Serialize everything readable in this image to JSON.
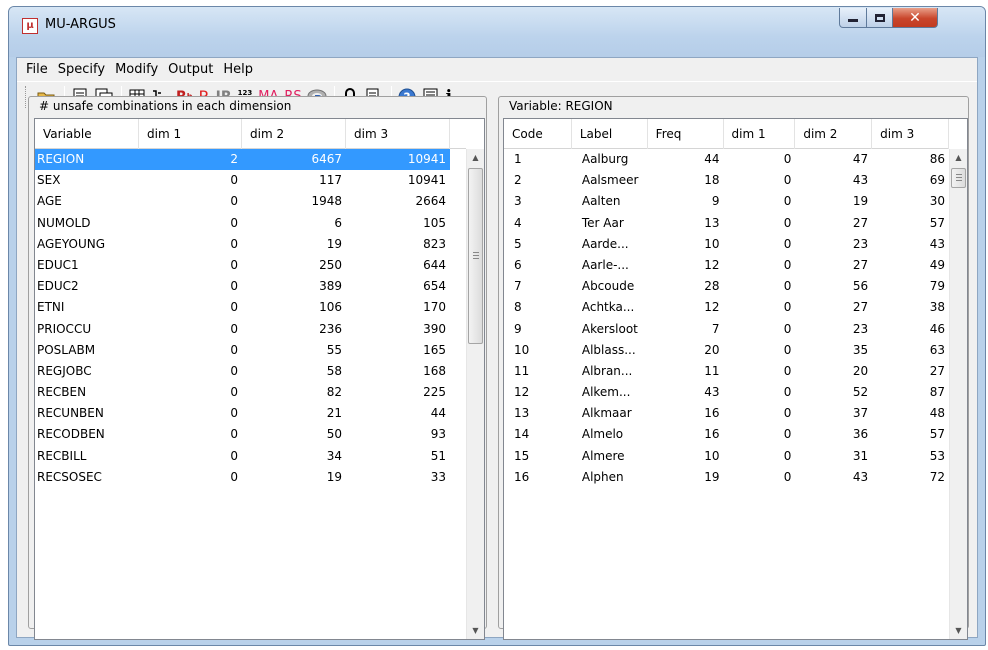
{
  "window": {
    "title": "MU-ARGUS",
    "icon": "mu-argus-app-icon"
  },
  "menu": [
    "File",
    "Specify",
    "Modify",
    "Output",
    "Help"
  ],
  "toolbar": {
    "buttons": [
      {
        "name": "open-icon",
        "glyph": ""
      },
      {
        "name": "document-icon",
        "glyph": ""
      },
      {
        "name": "documents-icon",
        "glyph": ""
      },
      {
        "name": "table-icon",
        "glyph": ""
      },
      {
        "name": "variables-icon",
        "glyph": ""
      },
      {
        "name": "recode-small-icon",
        "glyph": "R"
      },
      {
        "name": "recode-icon",
        "glyph": "R"
      },
      {
        "name": "pram-icon",
        "glyph": "IR"
      },
      {
        "name": "numeric-icon",
        "glyph": "123"
      },
      {
        "name": "microaggregation-icon",
        "glyph": "MA"
      },
      {
        "name": "rank-swapping-icon",
        "glyph": "RS"
      },
      {
        "name": "r-logo-icon",
        "glyph": "R"
      },
      {
        "name": "lock-icon",
        "glyph": ""
      },
      {
        "name": "report-icon",
        "glyph": ""
      },
      {
        "name": "help-icon",
        "glyph": "?"
      },
      {
        "name": "manual-icon",
        "glyph": ""
      },
      {
        "name": "info-icon",
        "glyph": "i"
      }
    ]
  },
  "colors": {
    "selection": "#3399ff",
    "titlebar": "#b9d1ea",
    "close": "#c9462c"
  },
  "left_panel": {
    "title": "# unsafe combinations in each dimension",
    "columns": [
      "Variable",
      "dim 1",
      "dim 2",
      "dim 3"
    ],
    "rows": [
      [
        "REGION",
        "2",
        "6467",
        "10941"
      ],
      [
        "SEX",
        "0",
        "117",
        "10941"
      ],
      [
        "AGE",
        "0",
        "1948",
        "2664"
      ],
      [
        "NUMOLD",
        "0",
        "6",
        "105"
      ],
      [
        "AGEYOUNG",
        "0",
        "19",
        "823"
      ],
      [
        "EDUC1",
        "0",
        "250",
        "644"
      ],
      [
        "EDUC2",
        "0",
        "389",
        "654"
      ],
      [
        "ETNI",
        "0",
        "106",
        "170"
      ],
      [
        "PRIOCCU",
        "0",
        "236",
        "390"
      ],
      [
        "POSLABM",
        "0",
        "55",
        "165"
      ],
      [
        "REGJOBC",
        "0",
        "58",
        "168"
      ],
      [
        "RECBEN",
        "0",
        "82",
        "225"
      ],
      [
        "RECUNBEN",
        "0",
        "21",
        "44"
      ],
      [
        "RECODBEN",
        "0",
        "50",
        "93"
      ],
      [
        "RECBILL",
        "0",
        "34",
        "51"
      ],
      [
        "RECSOSEC",
        "0",
        "19",
        "33"
      ]
    ],
    "selected_row": 0
  },
  "right_panel": {
    "title": "Variable:  REGION",
    "columns": [
      "Code",
      "Label",
      "Freq",
      "dim 1",
      "dim 2",
      "dim 3"
    ],
    "rows": [
      [
        "1",
        "Aalburg",
        "44",
        "0",
        "47",
        "86"
      ],
      [
        "2",
        "Aalsmeer",
        "18",
        "0",
        "43",
        "69"
      ],
      [
        "3",
        "Aalten",
        "9",
        "0",
        "19",
        "30"
      ],
      [
        "4",
        "Ter Aar",
        "13",
        "0",
        "27",
        "57"
      ],
      [
        "5",
        "Aarde...",
        "10",
        "0",
        "23",
        "43"
      ],
      [
        "6",
        "Aarle-...",
        "12",
        "0",
        "27",
        "49"
      ],
      [
        "7",
        "Abcoude",
        "28",
        "0",
        "56",
        "79"
      ],
      [
        "8",
        "Achtka...",
        "12",
        "0",
        "27",
        "38"
      ],
      [
        "9",
        "Akersloot",
        "7",
        "0",
        "23",
        "46"
      ],
      [
        "10",
        "Alblass...",
        "20",
        "0",
        "35",
        "63"
      ],
      [
        "11",
        "Albran...",
        "11",
        "0",
        "20",
        "27"
      ],
      [
        "12",
        "Alkem...",
        "43",
        "0",
        "52",
        "87"
      ],
      [
        "13",
        "Alkmaar",
        "16",
        "0",
        "37",
        "48"
      ],
      [
        "14",
        "Almelo",
        "16",
        "0",
        "36",
        "57"
      ],
      [
        "15",
        "Almere",
        "10",
        "0",
        "31",
        "53"
      ],
      [
        "16",
        "Alphen",
        "19",
        "0",
        "43",
        "72"
      ]
    ]
  }
}
